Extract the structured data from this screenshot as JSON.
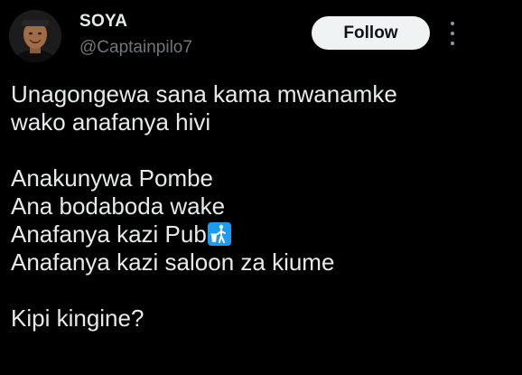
{
  "author": {
    "display_name": "SOYA",
    "handle": "@Captainpilo7"
  },
  "header": {
    "follow_label": "Follow",
    "more_icon": "more-vertical-icon"
  },
  "tweet": {
    "intro_line_1": "Unagongewa sana kama mwanamke",
    "intro_line_2": "wako anafanya hivi",
    "list_1": "Anakunywa Pombe",
    "list_2": "Ana bodaboda wake",
    "list_3": "Anafanya kazi Pub",
    "list_3_emoji": "litter-in-bin-icon",
    "list_4": "Anafanya kazi saloon za kiume",
    "closing": "Kipi kingine?"
  },
  "colors": {
    "background": "#000000",
    "text_primary": "#e7e9ea",
    "text_secondary": "#71767b",
    "follow_bg": "#eff3f4",
    "emoji_bg": "#1d9bf0"
  }
}
